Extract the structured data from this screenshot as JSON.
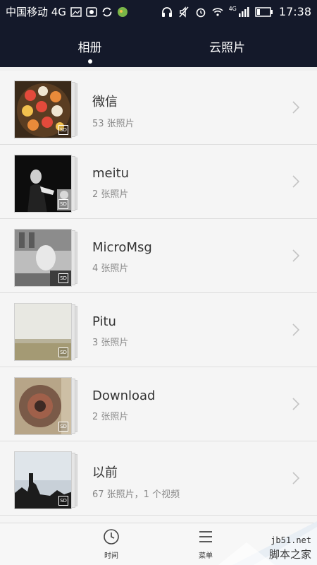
{
  "status_bar": {
    "carrier": "中国移动 4G",
    "time": "17:38",
    "network": "4G"
  },
  "header": {
    "tabs": [
      {
        "label": "相册",
        "active": true
      },
      {
        "label": "云照片",
        "active": false
      }
    ]
  },
  "albums": [
    {
      "name": "微信",
      "count": "53 张照片",
      "badge": "SD"
    },
    {
      "name": "meitu",
      "count": "2 张照片",
      "badge": "SD"
    },
    {
      "name": "MicroMsg",
      "count": "4 张照片",
      "badge": "SD"
    },
    {
      "name": "Pitu",
      "count": "3 张照片",
      "badge": "SD"
    },
    {
      "name": "Download",
      "count": "2 张照片",
      "badge": "SD"
    },
    {
      "name": "以前",
      "count": "67 张照片，1 个视频",
      "badge": "SD"
    }
  ],
  "bottom_bar": {
    "time_label": "时间",
    "menu_label": "菜单"
  },
  "watermark": {
    "site": "jb51.net",
    "name": "脚本之家"
  },
  "colors": {
    "header_bg": "#14192a",
    "list_bg": "#f5f5f5"
  }
}
